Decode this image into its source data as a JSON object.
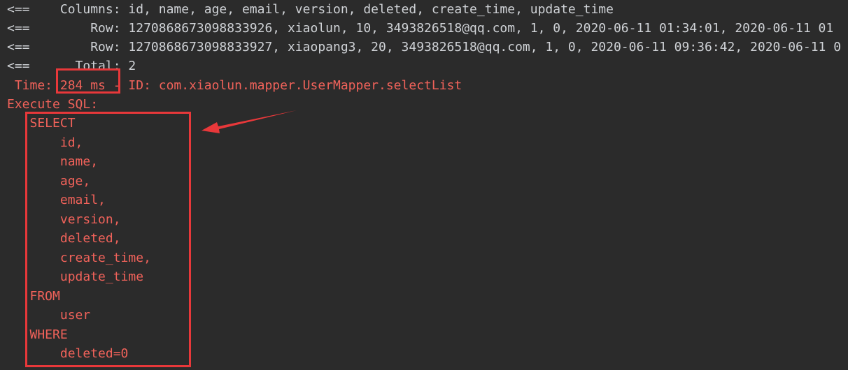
{
  "log": {
    "columns_line": "<==    Columns: id, name, age, email, version, deleted, create_time, update_time",
    "row1_line": "<==        Row: 1270868673098833926, xiaolun, 10, 3493826518@qq.com, 1, 0, 2020-06-11 01:34:01, 2020-06-11 01",
    "row2_line": "<==        Row: 1270868673098833927, xiaopang3, 20, 3493826518@qq.com, 1, 0, 2020-06-11 09:36:42, 2020-06-11 0",
    "total_line": "<==      Total: 2"
  },
  "perf": {
    "time_line": " Time: 284 ms - ID: com.xiaolun.mapper.UserMapper.selectList",
    "execute_label": "Execute SQL:"
  },
  "sql": [
    "   SELECT",
    "       id,",
    "       name,",
    "       age,",
    "       email,",
    "       version,",
    "       deleted,",
    "       create_time,",
    "       update_time",
    "   FROM",
    "       user",
    "   WHERE",
    "       deleted=0"
  ],
  "colors": {
    "background": "#2b2b2b",
    "log_text": "#cfd2d6",
    "sql_text": "#f0625a",
    "annotation": "#e8383a"
  }
}
